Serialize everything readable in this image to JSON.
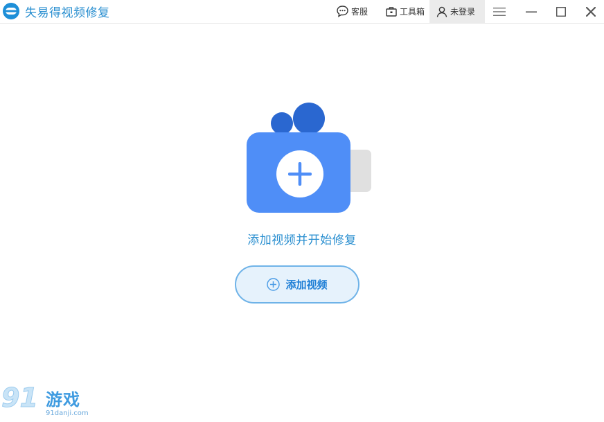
{
  "app": {
    "title": "失易得视频修复",
    "logo_icon": "app-logo-icon",
    "accent_color": "#2a8fd0"
  },
  "toolbar": {
    "service_label": "客服",
    "tools_label": "工具箱",
    "login_label": "未登录"
  },
  "main": {
    "prompt": "添加视频并开始修复",
    "add_button_label": "添加视频",
    "illustration_icon": "video-camera-add-icon"
  },
  "watermark": {
    "number": "91",
    "text": "游戏",
    "site": "91danji.com"
  }
}
